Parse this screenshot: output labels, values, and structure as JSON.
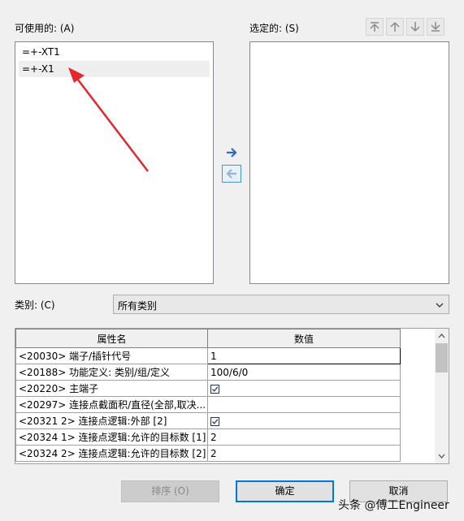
{
  "available": {
    "label": "可使用的: (A)",
    "items": [
      "=+-XT1",
      "=+-X1"
    ]
  },
  "selected": {
    "label": "选定的: (S)",
    "items": []
  },
  "order_buttons": [
    "move-top-icon",
    "move-up-icon",
    "move-down-icon",
    "move-bottom-icon"
  ],
  "transfer_buttons": [
    "arrow-right-icon",
    "arrow-left-icon"
  ],
  "category": {
    "label": "类别: (C)",
    "value": "所有类别"
  },
  "properties_table": {
    "columns": [
      "属性名",
      "数值"
    ],
    "rows": [
      {
        "name": "<20030> 端子/插针代号",
        "value": "1",
        "checkbox": false
      },
      {
        "name": "<20188> 功能定义: 类别/组/定义",
        "value": "100/6/0",
        "checkbox": false
      },
      {
        "name": "<20220> 主端子",
        "value": "",
        "checkbox": true
      },
      {
        "name": "<20297> 连接点截面积/直径(全部,取决...",
        "value": "",
        "checkbox": false
      },
      {
        "name": "<20321 2> 连接点逻辑:外部 [2]",
        "value": "",
        "checkbox": true
      },
      {
        "name": "<20324 1> 连接点逻辑:允许的目标数 [1]",
        "value": "2",
        "checkbox": false
      },
      {
        "name": "<20324 2> 连接点逻辑:允许的目标数 [2]",
        "value": "2",
        "checkbox": false
      }
    ]
  },
  "buttons": {
    "sort": "排序 (O)",
    "ok": "确定",
    "cancel": "取消"
  },
  "watermark": "头条 @傅工Engineer",
  "colors": {
    "annotation_arrow": "#e0282e",
    "accent": "#0078d7"
  }
}
